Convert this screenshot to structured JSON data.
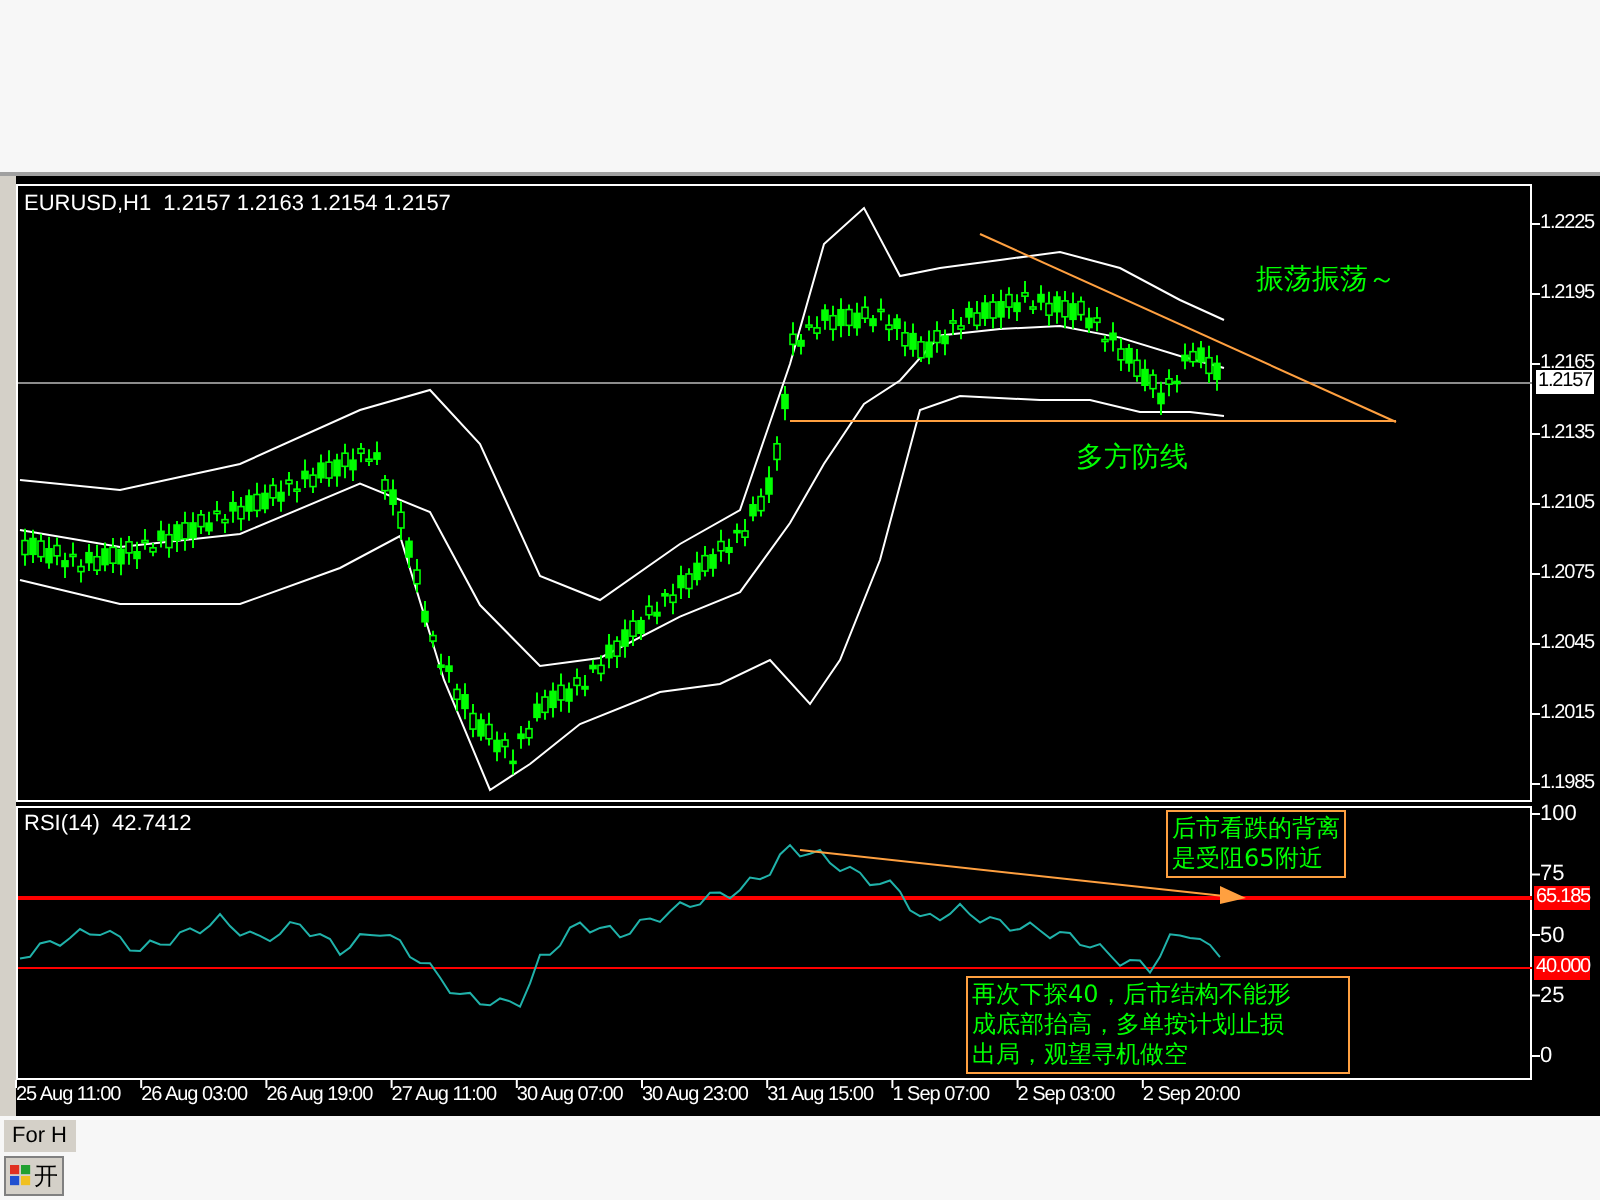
{
  "chart": {
    "symbol_label": "EURUSD,H1  1.2157 1.2163 1.2154 1.2157",
    "price_ticks": [
      "1.2225",
      "1.2195",
      "1.2165",
      "1.2135",
      "1.2105",
      "1.2075",
      "1.2045",
      "1.2015",
      "1.1985"
    ],
    "current_price": "1.2157",
    "annotations": [
      {
        "text": "振荡振荡～"
      },
      {
        "text": "多方防线"
      }
    ]
  },
  "rsi": {
    "label": "RSI(14)  42.7412",
    "ticks": [
      "100",
      "75",
      "50",
      "25",
      "0"
    ],
    "levels": [
      {
        "label": "65.185"
      },
      {
        "label": "40.000"
      }
    ],
    "notes": [
      {
        "lines": [
          "后市看跌的背离",
          "是受阻65附近"
        ]
      },
      {
        "lines": [
          "再次下探40，后市结构不能形",
          "成底部抬高，多单按计划止损",
          "出局，观望寻机做空"
        ]
      }
    ]
  },
  "time_labels": [
    "25 Aug 11:00",
    "26 Aug 03:00",
    "26 Aug 19:00",
    "27 Aug 11:00",
    "30 Aug 07:00",
    "30 Aug 23:00",
    "31 Aug 15:00",
    "1 Sep 07:00",
    "2 Sep 03:00",
    "2 Sep 20:00"
  ],
  "status_tab": "For H",
  "start_button": "开"
}
